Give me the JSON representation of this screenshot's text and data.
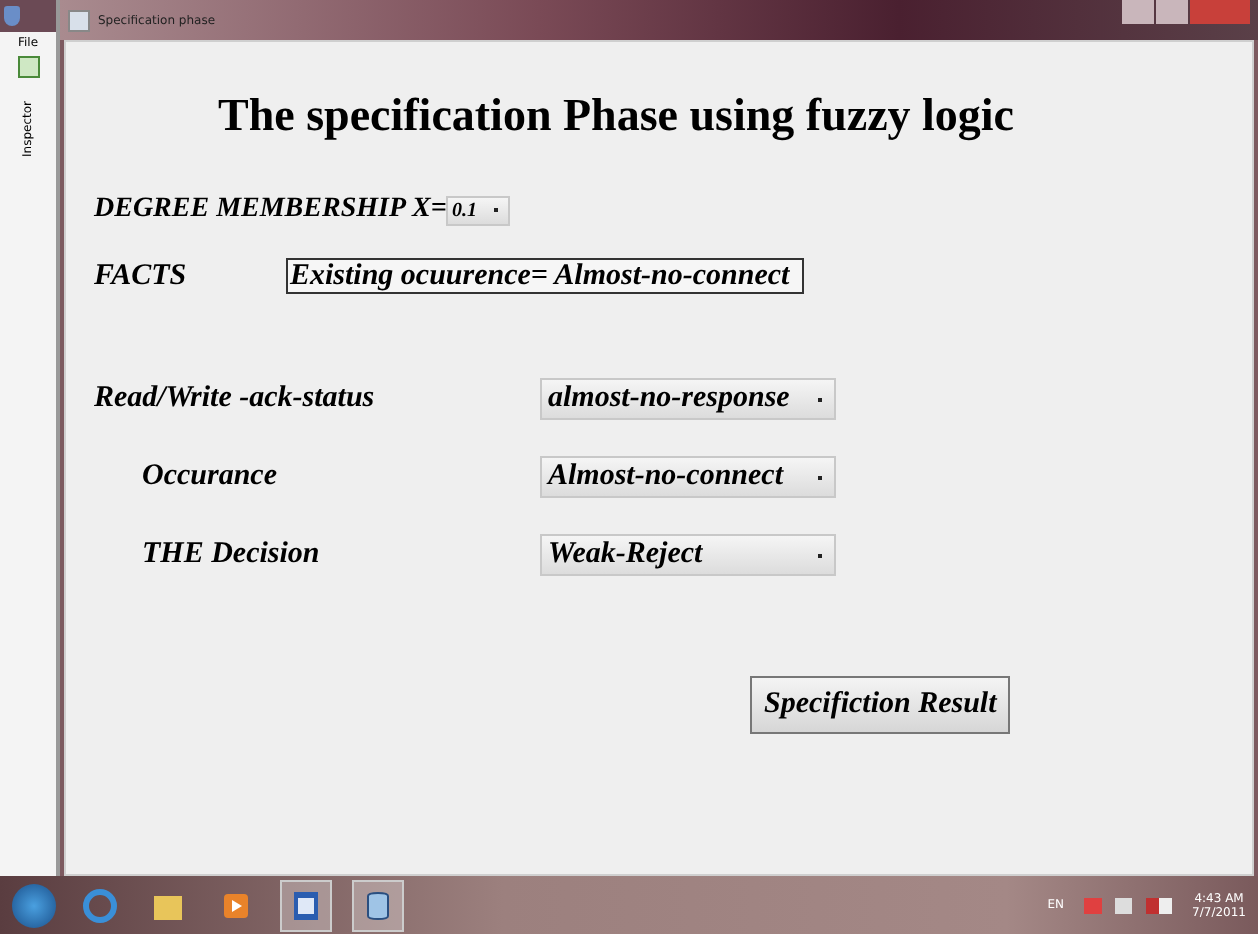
{
  "background_window": {
    "menu": "File",
    "panel_tab": "Inspector"
  },
  "window": {
    "title": "Specification phase"
  },
  "heading": "The specification Phase using fuzzy logic",
  "degree": {
    "label": "DEGREE MEMBERSHIP X=",
    "value": "0.1"
  },
  "facts": {
    "label": "FACTS",
    "value": "Existing ocuurence= Almost-no-connect"
  },
  "fields": [
    {
      "label": "Read/Write -ack-status",
      "value": "almost-no-response",
      "indent": false
    },
    {
      "label": "Occurance",
      "value": "Almost-no-connect",
      "indent": true
    },
    {
      "label": "THE Decision",
      "value": "Weak-Reject",
      "indent": true
    }
  ],
  "result_button": "Specifiction Result",
  "taskbar": {
    "language": "EN",
    "time": "4:43 AM",
    "date": "7/7/2011"
  }
}
